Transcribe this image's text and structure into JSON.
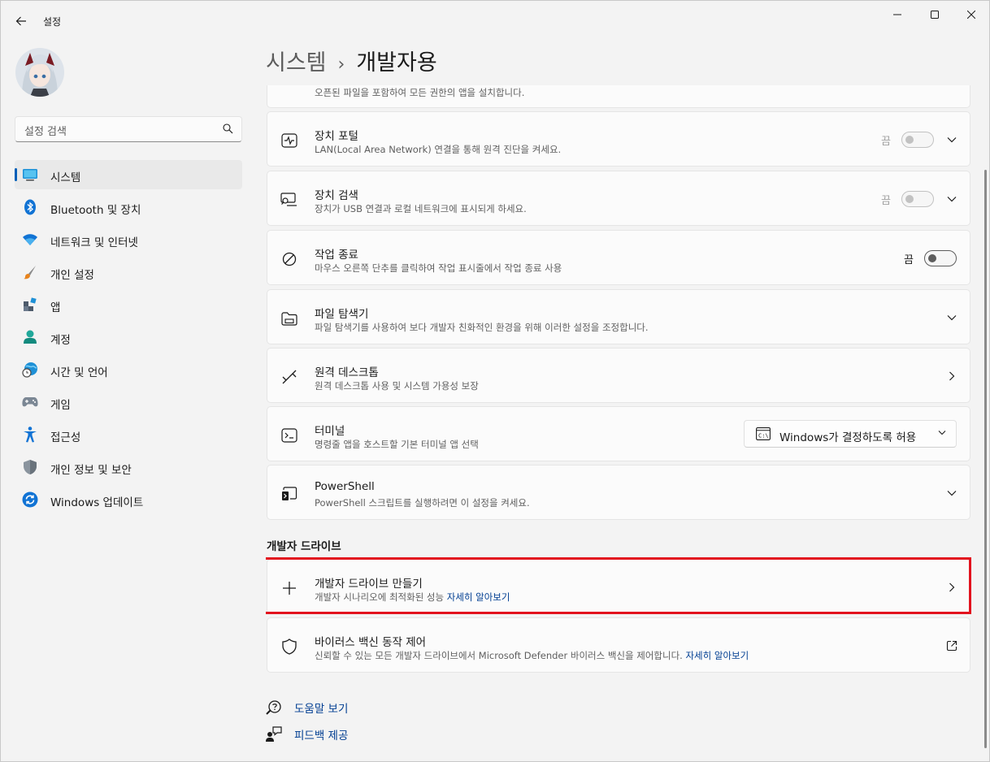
{
  "window": {
    "app_title": "설정",
    "controls": {
      "minimize_icon": "minimize-icon",
      "maximize_icon": "maximize-icon",
      "close_icon": "close-icon"
    }
  },
  "sidebar": {
    "search_placeholder": "설정 검색",
    "items": [
      {
        "label": "시스템",
        "icon": "monitor-icon",
        "selected": true
      },
      {
        "label": "Bluetooth 및 장치",
        "icon": "bluetooth-icon"
      },
      {
        "label": "네트워크 및 인터넷",
        "icon": "wifi-icon"
      },
      {
        "label": "개인 설정",
        "icon": "paintbrush-icon"
      },
      {
        "label": "앱",
        "icon": "apps-icon"
      },
      {
        "label": "계정",
        "icon": "person-icon"
      },
      {
        "label": "시간 및 언어",
        "icon": "globe-clock-icon"
      },
      {
        "label": "게임",
        "icon": "gamepad-icon"
      },
      {
        "label": "접근성",
        "icon": "accessibility-icon"
      },
      {
        "label": "개인 정보 및 보안",
        "icon": "shield-icon"
      },
      {
        "label": "Windows 업데이트",
        "icon": "update-icon"
      }
    ],
    "accent_color": "#005fb8"
  },
  "header": {
    "breadcrumb_parent": "시스템",
    "breadcrumb_separator": "›",
    "title": "개발자용"
  },
  "main": {
    "partial_card_desc": "오픈된 파일을 포함하여 모든 권한의 앱을 설치합니다.",
    "cards": [
      {
        "title": "장치 포털",
        "desc": "LAN(Local Area Network) 연결을 통해 원격 진단을 켜세요.",
        "icon": "pulse-icon",
        "toggle_label": "끔",
        "toggle_disabled": true,
        "chevron": "down"
      },
      {
        "title": "장치 검색",
        "desc": "장치가 USB 연결과 로컬 네트워크에 표시되게 하세요.",
        "icon": "device-search-icon",
        "toggle_label": "끔",
        "toggle_disabled": true,
        "chevron": "down"
      },
      {
        "title": "작업 종료",
        "desc": "마우스 오른쪽 단추를 클릭하여 작업 표시줄에서 작업 종료 사용",
        "icon": "prohibited-icon",
        "toggle_label": "끔",
        "toggle_disabled": false
      },
      {
        "title": "파일 탐색기",
        "desc": "파일 탐색기를 사용하여 보다 개발자 친화적인 환경을 위해 이러한 설정을 조정합니다.",
        "icon": "folder-icon",
        "chevron": "down"
      },
      {
        "title": "원격 데스크톱",
        "desc": "원격 데스크톱 사용 및 시스템 가용성 보장",
        "icon": "remote-desktop-icon",
        "chevron": "right"
      },
      {
        "title": "터미널",
        "desc": "명령줄 앱을 호스트할 기본 터미널 앱 선택",
        "icon": "terminal-icon",
        "dropdown_value": "Windows가 결정하도록 허용"
      },
      {
        "title": "PowerShell",
        "desc": "PowerShell 스크립트를 실행하려면 이 설정을 켜세요.",
        "icon": "powershell-icon",
        "chevron": "down"
      }
    ],
    "dev_drive_section_title": "개발자 드라이브",
    "dev_drive_cards": [
      {
        "title": "개발자 드라이브 만들기",
        "desc": "개발자 시나리오에 최적화된 성능",
        "link": "자세히 알아보기",
        "icon": "plus-icon",
        "chevron": "right"
      },
      {
        "title": "바이러스 백신 동작 제어",
        "desc": "신뢰할 수 있는 모든 개발자 드라이브에서 Microsoft Defender 바이러스 백신을 제어합니다.",
        "link": "자세히 알아보기",
        "icon": "shield-outline-icon",
        "trailing": "external-link-icon"
      }
    ],
    "highlight_color": "#e2121e"
  },
  "footer": {
    "help": "도움말 보기",
    "feedback": "피드백 제공"
  }
}
